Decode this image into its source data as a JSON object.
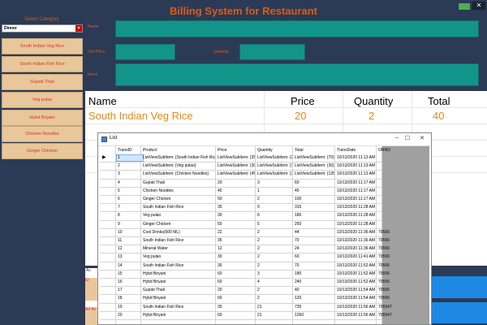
{
  "app_title": "Billing System for Restaurant",
  "category": {
    "label": "Select Category",
    "selected": "Dinner"
  },
  "menu_items": [
    "South Indian Veg Rice",
    "South Indian Fish Rice",
    "Gujrati Thali",
    "Veg pulao",
    "Hybd Biryani",
    "Chicken Noodles",
    "Ginger Chicken"
  ],
  "fields": {
    "name_label": "Name",
    "unit_price_label": "Unit Price",
    "quantity_label": "Quantity",
    "items_label": "Items"
  },
  "summary": {
    "headers": {
      "name": "Name",
      "price": "Price",
      "quantity": "Quantity",
      "total": "Total"
    },
    "values": {
      "name": "South Indian Veg Rice",
      "price": "20",
      "quantity": "2",
      "total": "40"
    }
  },
  "dialog": {
    "title": "List",
    "columns": [
      "TransID",
      "Product",
      "Price",
      "Quantity",
      "Total",
      "TransDate",
      "ORNO"
    ],
    "rows": [
      [
        "1",
        "ListViewSubItem: {South Indian Fish Rice}",
        "ListViewSubItem: {35}",
        "ListViewSubItem: {2}",
        "ListViewSubItem: {70}",
        "10/13/2020 11:13 AM",
        ""
      ],
      [
        "2",
        "ListViewSubItem: {Veg pulao}",
        "ListViewSubItem: {30}",
        "ListViewSubItem: {1}",
        "ListViewSubItem: {30}",
        "10/13/2020 11:13 AM",
        ""
      ],
      [
        "3",
        "ListViewSubItem: {Chicken Noodles}",
        "ListViewSubItem: {45}",
        "ListViewSubItem: {3}",
        "ListViewSubItem: {135}",
        "10/13/2020 11:13 AM",
        ""
      ],
      [
        "4",
        "Gujrati Thali",
        "20",
        "3",
        "60",
        "10/13/2020 11:17 AM",
        ""
      ],
      [
        "5",
        "Chicken Noodles",
        "45",
        "1",
        "45",
        "10/13/2020 11:17 AM",
        ""
      ],
      [
        "6",
        "Ginger Chicken",
        "50",
        "2",
        "100",
        "10/13/2020 11:17 AM",
        ""
      ],
      [
        "7",
        "South Indian Fish Rice",
        "35",
        "9",
        "315",
        "10/13/2020 11:28 AM",
        ""
      ],
      [
        "8",
        "Veg pulao",
        "30",
        "6",
        "180",
        "10/13/2020 11:28 AM",
        ""
      ],
      [
        "9",
        "Ginger Chicken",
        "50",
        "5",
        "250",
        "10/13/2020 11:28 AM",
        ""
      ],
      [
        "10",
        "Cool Drinks(500 ML)",
        "22",
        "2",
        "44",
        "10/13/2020 11:36 AM",
        "70556"
      ],
      [
        "11",
        "South Indian Fish Rice",
        "35",
        "2",
        "70",
        "10/13/2020 11:36 AM",
        "70556"
      ],
      [
        "12",
        "Mineral Water",
        "12",
        "2",
        "24",
        "10/13/2020 11:36 AM",
        "70556"
      ],
      [
        "13",
        "Veg pulao",
        "30",
        "2",
        "60",
        "10/13/2020 11:41 AM",
        "70556"
      ],
      [
        "14",
        "South Indian Fish Rice",
        "35",
        "2",
        "70",
        "10/13/2020 11:52 AM",
        "70556"
      ],
      [
        "15",
        "Hybd Biryani",
        "60",
        "3",
        "180",
        "10/13/2020 11:52 AM",
        "70556"
      ],
      [
        "16",
        "Hybd Biryani",
        "60",
        "4",
        "240",
        "10/13/2020 11:52 AM",
        "70556"
      ],
      [
        "17",
        "Gujrati Thali",
        "20",
        "2",
        "40",
        "10/13/2020 11:54 AM",
        "70556"
      ],
      [
        "18",
        "Hybd Biryani",
        "60",
        "2",
        "120",
        "10/13/2020 11:54 AM",
        "70556"
      ],
      [
        "19",
        "South Indian Fish Rice",
        "35",
        "21",
        "735",
        "10/13/2020 11:56 AM",
        "705547"
      ],
      [
        "20",
        "Hybd Biryani",
        "60",
        "21",
        "1260",
        "10/13/2020 11:56 AM",
        "705547"
      ]
    ]
  },
  "bottom": {
    "label_ac": "Ac",
    "btn1": "Er",
    "btn2": "Ad Ite"
  },
  "colors": {
    "accent": "#e05a12",
    "teal": "#13948a",
    "background": "#2b3a55",
    "menu_button": "#e8c79a"
  }
}
